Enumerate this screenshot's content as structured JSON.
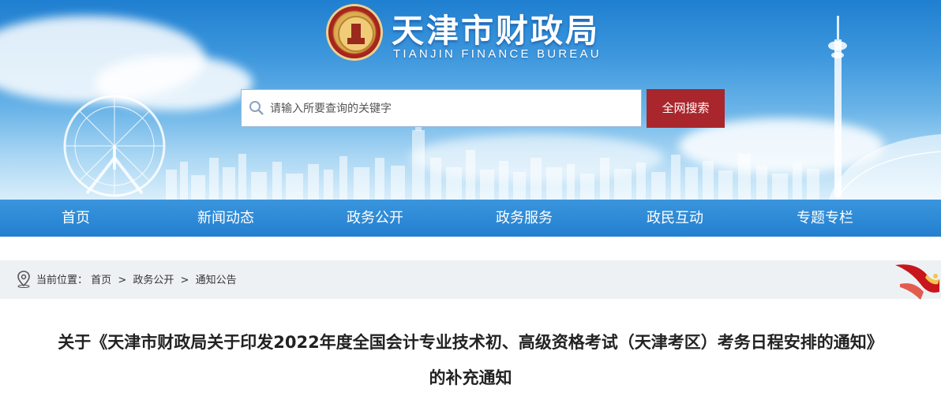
{
  "header": {
    "site_title": "天津市财政局",
    "site_subtitle": "TIANJIN FINANCE BUREAU",
    "search": {
      "placeholder": "请输入所要查询的关键字",
      "value": "",
      "button_label": "全网搜索"
    }
  },
  "nav": {
    "items": [
      {
        "label": "首页"
      },
      {
        "label": "新闻动态"
      },
      {
        "label": "政务公开"
      },
      {
        "label": "政务服务"
      },
      {
        "label": "政民互动"
      },
      {
        "label": "专题专栏"
      }
    ]
  },
  "breadcrumb": {
    "prefix": "当前位置：",
    "items": [
      "首页",
      "政务公开",
      "通知公告"
    ],
    "separator": ">"
  },
  "article": {
    "title_line1": "关于《天津市财政局关于印发2022年度全国会计专业技术初、高级资格考试（天津考区）考务日程安排的通知》",
    "title_line2": "的补充通知"
  },
  "colors": {
    "nav_bg": "#2a86d3",
    "search_button": "#a8262c",
    "crumb_bg": "#eef1f4"
  }
}
